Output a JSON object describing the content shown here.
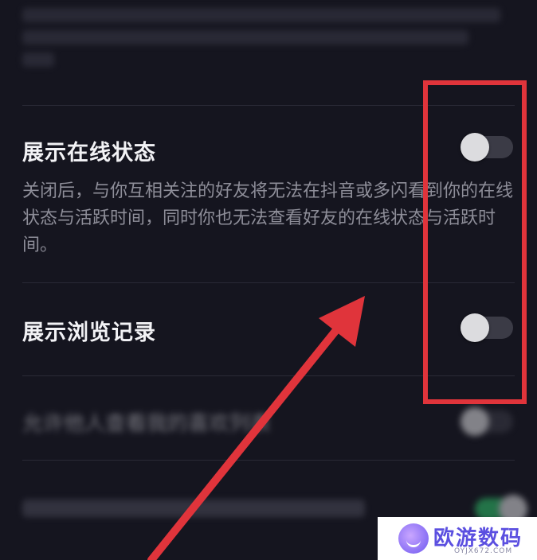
{
  "settings": {
    "online_status": {
      "title": "展示在线状态",
      "description": "关闭后，与你互相关注的好友将无法在抖音或多闪看到你的在线状态与活跃时间，同时你也无法查看好友的在线状态与活跃时间。",
      "enabled": false
    },
    "browse_history": {
      "title": "展示浏览记录",
      "enabled": false
    },
    "likes_list": {
      "title": "允许他人查看我的喜欢列表",
      "enabled": false
    }
  },
  "watermark": {
    "title": "欧游数码",
    "subtitle": "OYJX672.COM"
  },
  "colors": {
    "background": "#15151f",
    "highlight": "#e0343b",
    "toggle_off": "#3b3b46",
    "toggle_on": "#2fc16a"
  }
}
